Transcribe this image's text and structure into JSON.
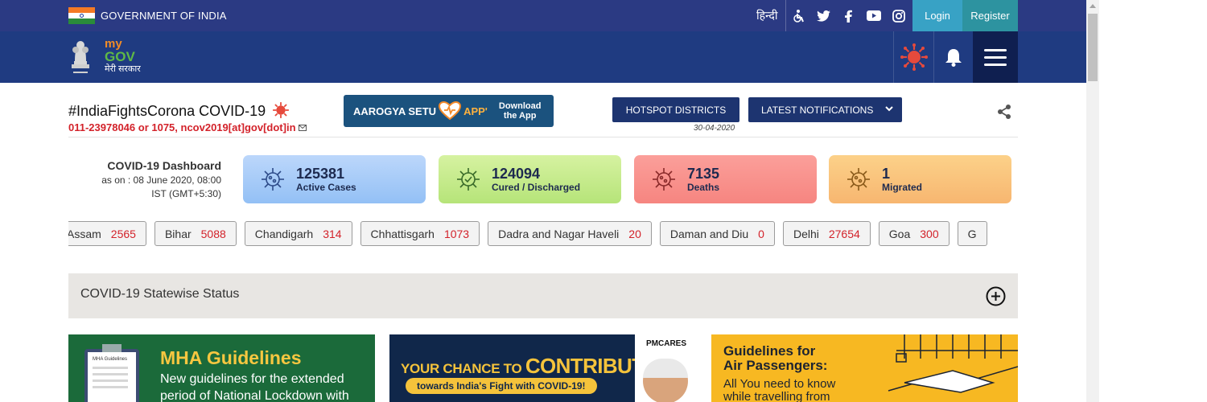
{
  "gov_bar": {
    "title": "GOVERNMENT OF INDIA",
    "language": "हिन्दी",
    "social_icons": [
      "accessibility-icon",
      "twitter-icon",
      "facebook-icon",
      "youtube-icon",
      "instagram-icon"
    ],
    "login": "Login",
    "register": "Register"
  },
  "logo": {
    "line1": "my",
    "line2": "GOV",
    "line3": "मेरी सरकार"
  },
  "corona_info": {
    "hashtag": "#IndiaFightsCorona COVID-19",
    "helpline": "011-23978046 or 1075, ncov2019[at]gov[dot]in"
  },
  "aarogya": {
    "label_left": "AAROGYA SETU",
    "label_right": "APP'",
    "download_line1": "Download",
    "download_line2": "the App"
  },
  "buttons": {
    "hotspot": "HOTSPOT DISTRICTS",
    "hotspot_date": "30-04-2020",
    "notifications": "LATEST NOTIFICATIONS"
  },
  "dashboard": {
    "title": "COVID-19 Dashboard",
    "asof_line1": "as on : 08 June 2020, 08:00",
    "asof_line2": "IST (GMT+5:30)",
    "stats": [
      {
        "value": "125381",
        "label": "Active Cases"
      },
      {
        "value": "124094",
        "label": "Cured / Discharged"
      },
      {
        "value": "7135",
        "label": "Deaths"
      },
      {
        "value": "1",
        "label": "Migrated"
      }
    ]
  },
  "states": [
    {
      "name": "Assam",
      "count": "2565"
    },
    {
      "name": "Bihar",
      "count": "5088"
    },
    {
      "name": "Chandigarh",
      "count": "314"
    },
    {
      "name": "Chhattisgarh",
      "count": "1073"
    },
    {
      "name": "Dadra and Nagar Haveli",
      "count": "20"
    },
    {
      "name": "Daman and Diu",
      "count": "0"
    },
    {
      "name": "Delhi",
      "count": "27654"
    },
    {
      "name": "Goa",
      "count": "300"
    },
    {
      "name": "G",
      "count": ""
    }
  ],
  "statewise": {
    "title": "COVID-19 Statewise Status"
  },
  "banners": {
    "mha_title": "MHA Guidelines",
    "mha_text_1": "New guidelines for the extended",
    "mha_text_2": "period of National Lockdown with",
    "mha_clip_label": "MHA Guidelines",
    "pm_logo": "PMCARES",
    "contribute_1": "YOUR CHANCE TO ",
    "contribute_2": "CONTRIBUTE",
    "contribute_3": "towards India's Fight with COVID-19!",
    "air_title_1": "Guidelines for",
    "air_title_2": "Air Passengers:",
    "air_text_1": "All You need to know",
    "air_text_2": "while travelling from"
  },
  "colors": {
    "gov_bar": "#2b3a83",
    "header": "#1f3b81",
    "accent_red": "#d3222a",
    "button_dark": "#1d3470"
  }
}
